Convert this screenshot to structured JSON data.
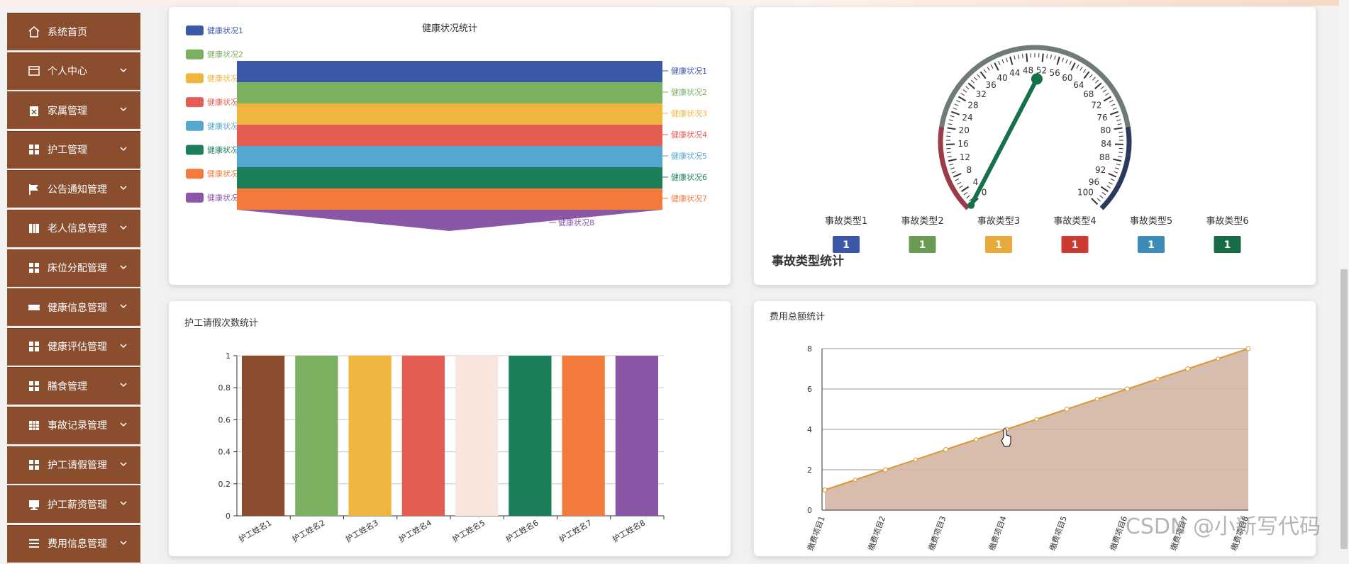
{
  "sidebar": {
    "items": [
      {
        "label": "系统首页",
        "icon": "home-icon",
        "chevron": false
      },
      {
        "label": "个人中心",
        "icon": "card-icon",
        "chevron": true
      },
      {
        "label": "家属管理",
        "icon": "clipboard-icon",
        "chevron": true
      },
      {
        "label": "护工管理",
        "icon": "grid-icon",
        "chevron": true
      },
      {
        "label": "公告通知管理",
        "icon": "flag-icon",
        "chevron": true
      },
      {
        "label": "老人信息管理",
        "icon": "book-icon",
        "chevron": true
      },
      {
        "label": "床位分配管理",
        "icon": "grid-icon",
        "chevron": true
      },
      {
        "label": "健康信息管理",
        "icon": "ticket-icon",
        "chevron": true
      },
      {
        "label": "健康评估管理",
        "icon": "grid-icon",
        "chevron": true
      },
      {
        "label": "膳食管理",
        "icon": "grid-icon",
        "chevron": true
      },
      {
        "label": "事故记录管理",
        "icon": "table-icon",
        "chevron": true
      },
      {
        "label": "护工请假管理",
        "icon": "grid-icon",
        "chevron": true
      },
      {
        "label": "护工薪资管理",
        "icon": "monitor-icon",
        "chevron": true
      },
      {
        "label": "费用信息管理",
        "icon": "list-icon",
        "chevron": true
      }
    ]
  },
  "watermark": "CSDN @小新写代码",
  "colors": {
    "sidebar_bg": "#8a4e2f",
    "palette": [
      "#3b57a7",
      "#7cb061",
      "#f0b53f",
      "#e45c52",
      "#55a7cf",
      "#1b7f5a",
      "#f27a3a",
      "#8a56a6"
    ]
  },
  "chart_data": [
    {
      "id": "funnel",
      "type": "funnel",
      "title": "健康状况统计",
      "categories": [
        "健康状况1",
        "健康状况2",
        "健康状况3",
        "健康状况4",
        "健康状况5",
        "健康状况6",
        "健康状况7",
        "健康状况8"
      ],
      "values": [
        1,
        1,
        1,
        1,
        1,
        1,
        1,
        1
      ],
      "legend": "left"
    },
    {
      "id": "gauge",
      "type": "gauge",
      "title": "事故类型统计",
      "range": [
        0,
        100
      ],
      "ticks": [
        0,
        4,
        8,
        12,
        16,
        20,
        24,
        28,
        32,
        36,
        40,
        44,
        48,
        52,
        56,
        60,
        64,
        68,
        72,
        76,
        80,
        84,
        88,
        92,
        96,
        100
      ],
      "value": 1,
      "categories": [
        "事故类型1",
        "事故类型2",
        "事故类型3",
        "事故类型4",
        "事故类型5",
        "事故类型6"
      ],
      "values": [
        1,
        1,
        1,
        1,
        1,
        1
      ],
      "badge_colors": [
        "#3b57a7",
        "#6a9a54",
        "#e6a93a",
        "#cc3a33",
        "#3f8bb8",
        "#176b45"
      ]
    },
    {
      "id": "bar",
      "type": "bar",
      "title": "护工请假次数统计",
      "categories": [
        "护工姓名1",
        "护工姓名2",
        "护工姓名3",
        "护工姓名4",
        "护工姓名5",
        "护工姓名6",
        "护工姓名7",
        "护工姓名8"
      ],
      "values": [
        1,
        1,
        1,
        1,
        1,
        1,
        1,
        1
      ],
      "bar_colors": [
        "#8a4e2f",
        "#7cb061",
        "#f0b53f",
        "#e45c52",
        "#f8e6dc",
        "#1b7f5a",
        "#f27a3a",
        "#8a56a6"
      ],
      "ylim": [
        0,
        1
      ],
      "yticks": [
        "0",
        "0.2",
        "0.4",
        "0.6",
        "0.8",
        "1"
      ],
      "grid": true
    },
    {
      "id": "area",
      "type": "area",
      "title": "费用总额统计",
      "categories": [
        "缴费项目1",
        "缴费项目2",
        "缴费项目3",
        "缴费项目4",
        "缴费项目5",
        "缴费项目6",
        "缴费项目7",
        "缴费项目8"
      ],
      "values": [
        1,
        2,
        3,
        4,
        5,
        6,
        7,
        8
      ],
      "ylim": [
        0,
        8
      ],
      "yticks": [
        "0",
        "2",
        "4",
        "6",
        "8"
      ],
      "line_color": "#d79a33",
      "fill_color": "#d4b6a5",
      "grid": true
    }
  ]
}
